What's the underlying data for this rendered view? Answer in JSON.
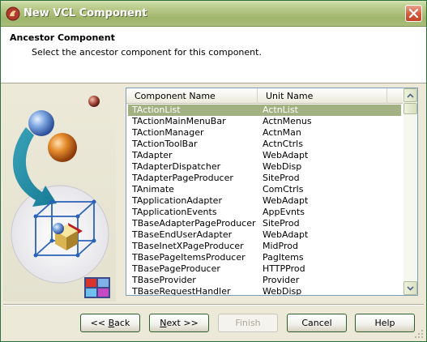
{
  "window": {
    "title": "New VCL Component"
  },
  "header": {
    "title": "Ancestor Component",
    "subtitle": "Select the ancestor component for this component."
  },
  "list": {
    "columns": [
      "Component Name",
      "Unit Name"
    ],
    "selected_index": 0,
    "rows": [
      {
        "name": "TActionList",
        "unit": "ActnList"
      },
      {
        "name": "TActionMainMenuBar",
        "unit": "ActnMenus"
      },
      {
        "name": "TActionManager",
        "unit": "ActnMan"
      },
      {
        "name": "TActionToolBar",
        "unit": "ActnCtrls"
      },
      {
        "name": "TAdapter",
        "unit": "WebAdapt"
      },
      {
        "name": "TAdapterDispatcher",
        "unit": "WebDisp"
      },
      {
        "name": "TAdapterPageProducer",
        "unit": "SiteProd"
      },
      {
        "name": "TAnimate",
        "unit": "ComCtrls"
      },
      {
        "name": "TApplicationAdapter",
        "unit": "WebAdapt"
      },
      {
        "name": "TApplicationEvents",
        "unit": "AppEvnts"
      },
      {
        "name": "TBaseAdapterPageProducer",
        "unit": "SiteProd"
      },
      {
        "name": "TBaseEndUserAdapter",
        "unit": "WebAdapt"
      },
      {
        "name": "TBaseInetXPageProducer",
        "unit": "MidProd"
      },
      {
        "name": "TBasePageItemsProducer",
        "unit": "PagItems"
      },
      {
        "name": "TBasePageProducer",
        "unit": "HTTPProd"
      },
      {
        "name": "TBaseProvider",
        "unit": "Provider"
      },
      {
        "name": "TBaseRequestHandler",
        "unit": "WebDisp"
      }
    ]
  },
  "buttons": {
    "back": {
      "prefix": "<< ",
      "accel": "B",
      "rest": "ack"
    },
    "next": {
      "accel": "N",
      "rest": "ext >>"
    },
    "finish": "Finish",
    "cancel": "Cancel",
    "help": "Help"
  },
  "icons": {
    "title": "component-wizard-icon",
    "close": "close-icon",
    "scroll_up": "scroll-up-arrow-icon",
    "scroll_down": "scroll-down-arrow-icon"
  },
  "colors": {
    "titlebar": "#a9bd79",
    "selection": "#a2b182",
    "close": "#d35b3c"
  }
}
